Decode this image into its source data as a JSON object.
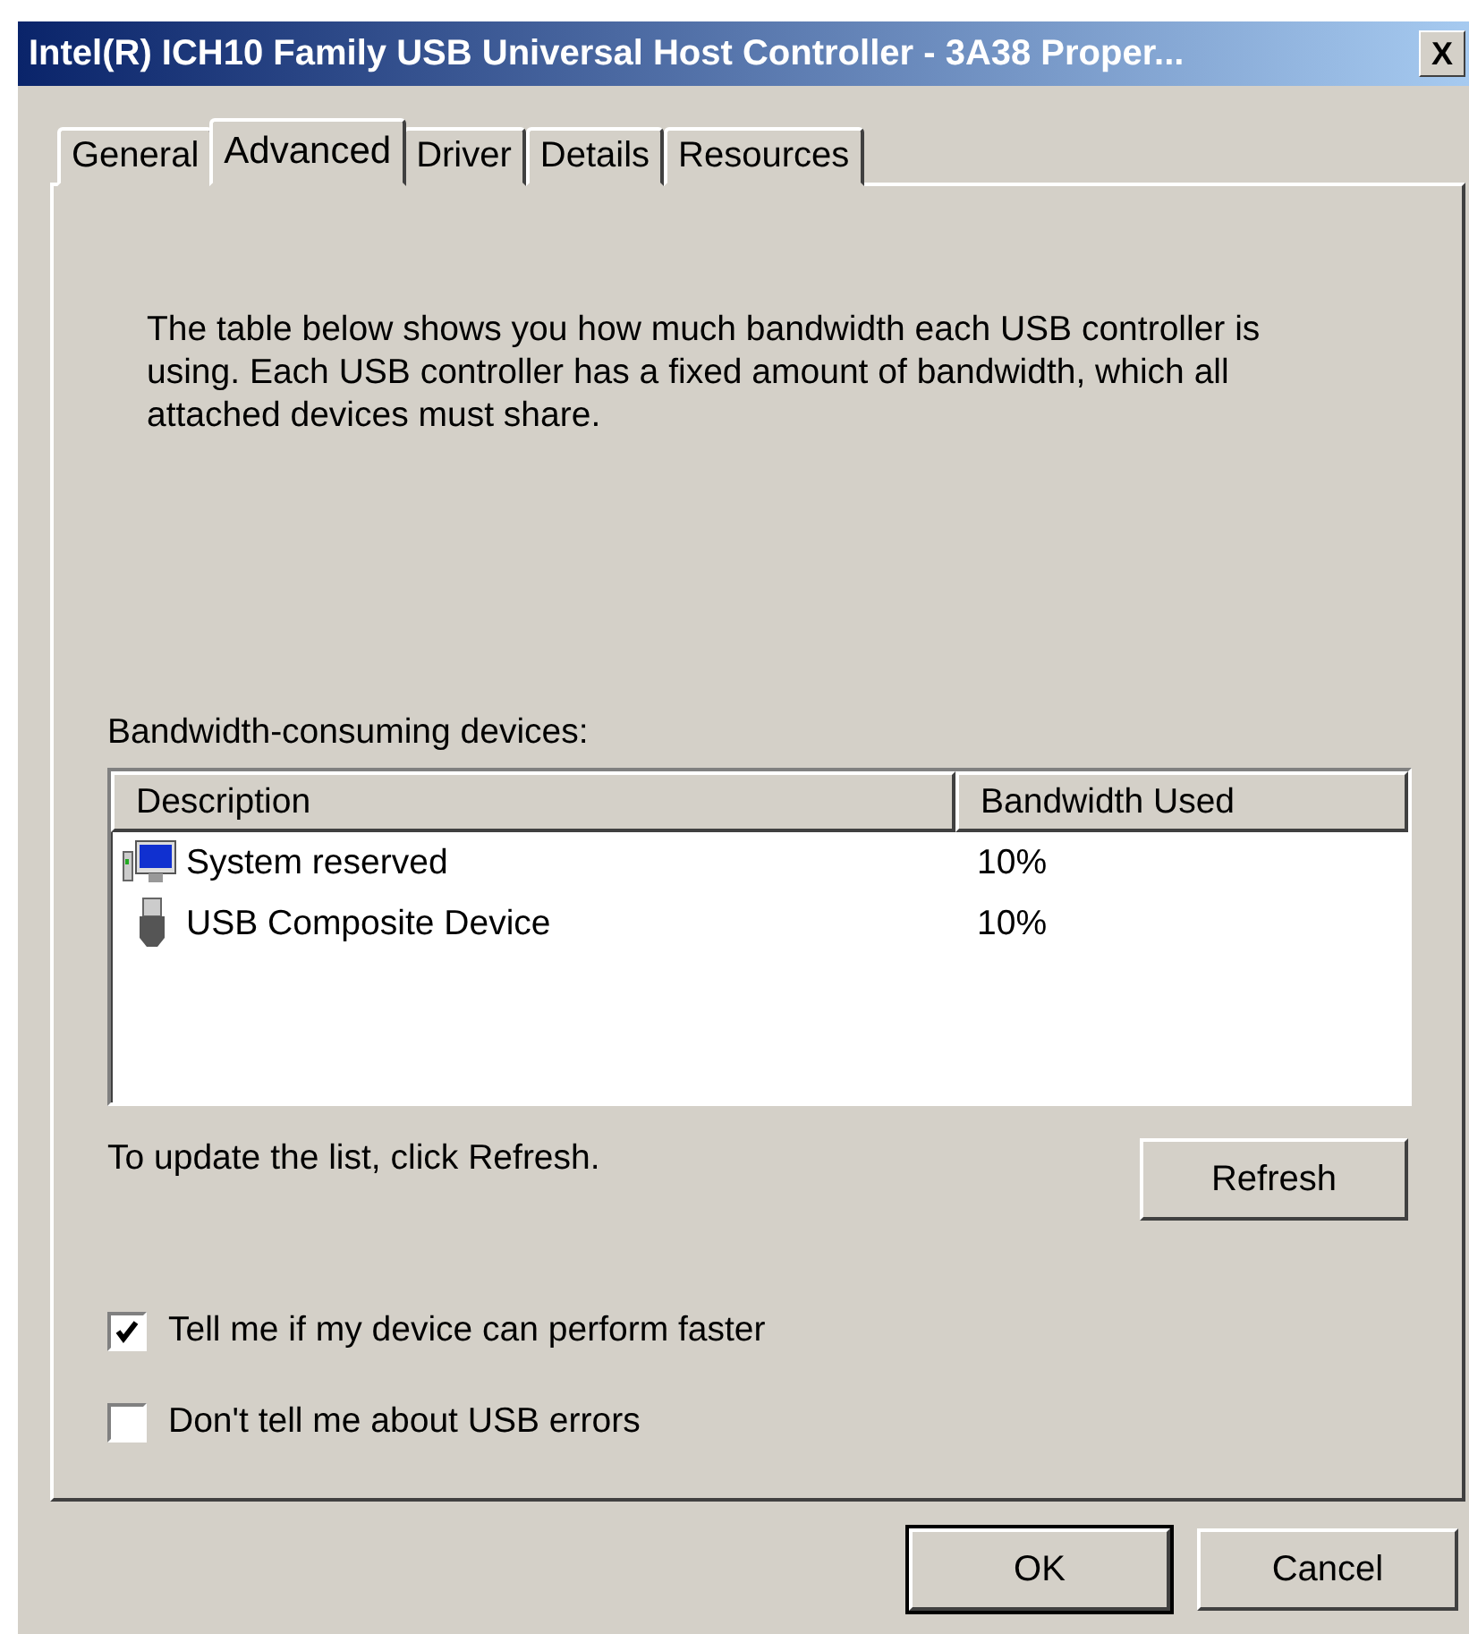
{
  "window": {
    "title": "Intel(R) ICH10 Family USB Universal Host Controller - 3A38 Proper...",
    "close": "X"
  },
  "tabs": [
    {
      "label": "General",
      "selected": false
    },
    {
      "label": "Advanced",
      "selected": true
    },
    {
      "label": "Driver",
      "selected": false
    },
    {
      "label": "Details",
      "selected": false
    },
    {
      "label": "Resources",
      "selected": false
    }
  ],
  "description": "The table below shows you how much bandwidth each USB controller is using. Each USB controller has a fixed amount of bandwidth, which all attached devices must share.",
  "devices_label": "Bandwidth-consuming devices:",
  "table": {
    "columns": [
      "Description",
      "Bandwidth Used"
    ],
    "rows": [
      {
        "kind": "computer",
        "description": "System reserved",
        "bandwidth": "10%"
      },
      {
        "kind": "usb",
        "description": "USB Composite Device",
        "bandwidth": "10%"
      }
    ]
  },
  "refresh_hint": "To update the list, click Refresh.",
  "refresh_button": "Refresh",
  "options": [
    {
      "label": "Tell me if my device can perform faster",
      "checked": true
    },
    {
      "label": "Don't tell me about USB errors",
      "checked": false
    }
  ],
  "buttons": [
    "OK",
    "Cancel"
  ]
}
